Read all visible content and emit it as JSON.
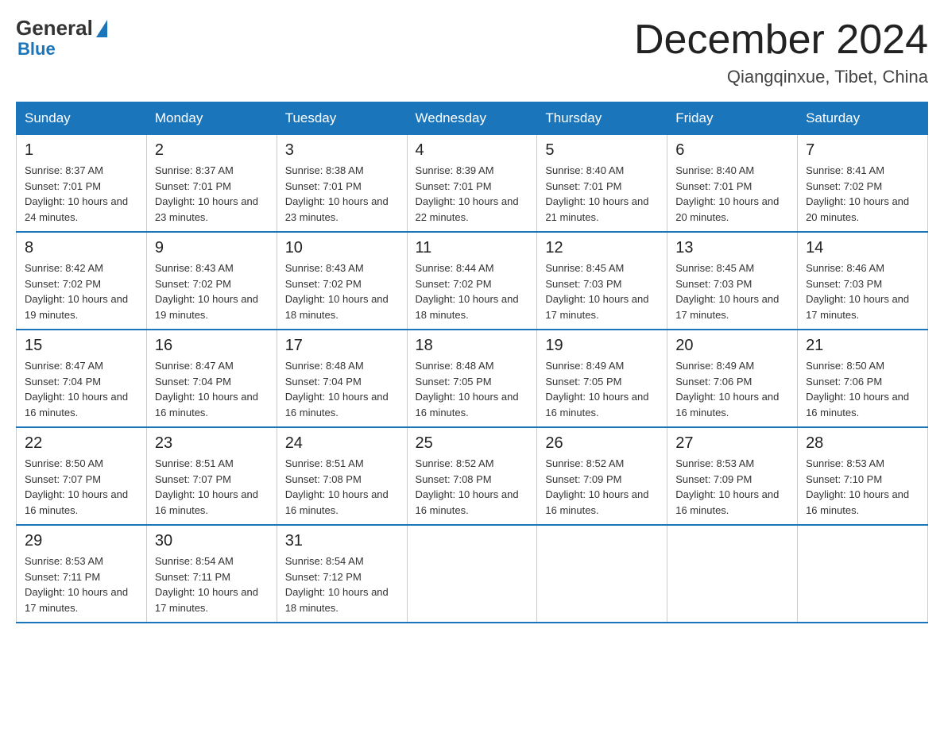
{
  "header": {
    "logo_general": "General",
    "logo_blue": "Blue",
    "month_title": "December 2024",
    "location": "Qiangqinxue, Tibet, China"
  },
  "weekdays": [
    "Sunday",
    "Monday",
    "Tuesday",
    "Wednesday",
    "Thursday",
    "Friday",
    "Saturday"
  ],
  "weeks": [
    [
      {
        "day": "1",
        "sunrise": "8:37 AM",
        "sunset": "7:01 PM",
        "daylight": "10 hours and 24 minutes."
      },
      {
        "day": "2",
        "sunrise": "8:37 AM",
        "sunset": "7:01 PM",
        "daylight": "10 hours and 23 minutes."
      },
      {
        "day": "3",
        "sunrise": "8:38 AM",
        "sunset": "7:01 PM",
        "daylight": "10 hours and 23 minutes."
      },
      {
        "day": "4",
        "sunrise": "8:39 AM",
        "sunset": "7:01 PM",
        "daylight": "10 hours and 22 minutes."
      },
      {
        "day": "5",
        "sunrise": "8:40 AM",
        "sunset": "7:01 PM",
        "daylight": "10 hours and 21 minutes."
      },
      {
        "day": "6",
        "sunrise": "8:40 AM",
        "sunset": "7:01 PM",
        "daylight": "10 hours and 20 minutes."
      },
      {
        "day": "7",
        "sunrise": "8:41 AM",
        "sunset": "7:02 PM",
        "daylight": "10 hours and 20 minutes."
      }
    ],
    [
      {
        "day": "8",
        "sunrise": "8:42 AM",
        "sunset": "7:02 PM",
        "daylight": "10 hours and 19 minutes."
      },
      {
        "day": "9",
        "sunrise": "8:43 AM",
        "sunset": "7:02 PM",
        "daylight": "10 hours and 19 minutes."
      },
      {
        "day": "10",
        "sunrise": "8:43 AM",
        "sunset": "7:02 PM",
        "daylight": "10 hours and 18 minutes."
      },
      {
        "day": "11",
        "sunrise": "8:44 AM",
        "sunset": "7:02 PM",
        "daylight": "10 hours and 18 minutes."
      },
      {
        "day": "12",
        "sunrise": "8:45 AM",
        "sunset": "7:03 PM",
        "daylight": "10 hours and 17 minutes."
      },
      {
        "day": "13",
        "sunrise": "8:45 AM",
        "sunset": "7:03 PM",
        "daylight": "10 hours and 17 minutes."
      },
      {
        "day": "14",
        "sunrise": "8:46 AM",
        "sunset": "7:03 PM",
        "daylight": "10 hours and 17 minutes."
      }
    ],
    [
      {
        "day": "15",
        "sunrise": "8:47 AM",
        "sunset": "7:04 PM",
        "daylight": "10 hours and 16 minutes."
      },
      {
        "day": "16",
        "sunrise": "8:47 AM",
        "sunset": "7:04 PM",
        "daylight": "10 hours and 16 minutes."
      },
      {
        "day": "17",
        "sunrise": "8:48 AM",
        "sunset": "7:04 PM",
        "daylight": "10 hours and 16 minutes."
      },
      {
        "day": "18",
        "sunrise": "8:48 AM",
        "sunset": "7:05 PM",
        "daylight": "10 hours and 16 minutes."
      },
      {
        "day": "19",
        "sunrise": "8:49 AM",
        "sunset": "7:05 PM",
        "daylight": "10 hours and 16 minutes."
      },
      {
        "day": "20",
        "sunrise": "8:49 AM",
        "sunset": "7:06 PM",
        "daylight": "10 hours and 16 minutes."
      },
      {
        "day": "21",
        "sunrise": "8:50 AM",
        "sunset": "7:06 PM",
        "daylight": "10 hours and 16 minutes."
      }
    ],
    [
      {
        "day": "22",
        "sunrise": "8:50 AM",
        "sunset": "7:07 PM",
        "daylight": "10 hours and 16 minutes."
      },
      {
        "day": "23",
        "sunrise": "8:51 AM",
        "sunset": "7:07 PM",
        "daylight": "10 hours and 16 minutes."
      },
      {
        "day": "24",
        "sunrise": "8:51 AM",
        "sunset": "7:08 PM",
        "daylight": "10 hours and 16 minutes."
      },
      {
        "day": "25",
        "sunrise": "8:52 AM",
        "sunset": "7:08 PM",
        "daylight": "10 hours and 16 minutes."
      },
      {
        "day": "26",
        "sunrise": "8:52 AM",
        "sunset": "7:09 PM",
        "daylight": "10 hours and 16 minutes."
      },
      {
        "day": "27",
        "sunrise": "8:53 AM",
        "sunset": "7:09 PM",
        "daylight": "10 hours and 16 minutes."
      },
      {
        "day": "28",
        "sunrise": "8:53 AM",
        "sunset": "7:10 PM",
        "daylight": "10 hours and 16 minutes."
      }
    ],
    [
      {
        "day": "29",
        "sunrise": "8:53 AM",
        "sunset": "7:11 PM",
        "daylight": "10 hours and 17 minutes."
      },
      {
        "day": "30",
        "sunrise": "8:54 AM",
        "sunset": "7:11 PM",
        "daylight": "10 hours and 17 minutes."
      },
      {
        "day": "31",
        "sunrise": "8:54 AM",
        "sunset": "7:12 PM",
        "daylight": "10 hours and 18 minutes."
      },
      null,
      null,
      null,
      null
    ]
  ]
}
